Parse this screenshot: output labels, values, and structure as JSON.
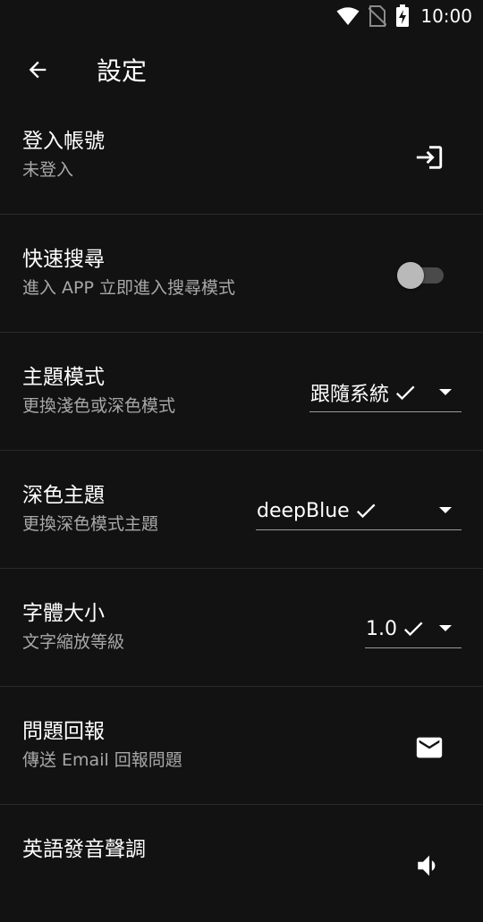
{
  "status_bar": {
    "time": "10:00",
    "icons": [
      "wifi-icon",
      "no-sim-icon",
      "battery-charging-icon"
    ]
  },
  "app_bar": {
    "back_icon": "arrow-left-icon",
    "title": "設定"
  },
  "settings": {
    "login": {
      "title": "登入帳號",
      "subtitle": "未登入",
      "icon": "login-icon"
    },
    "quick_search": {
      "title": "快速搜尋",
      "subtitle": "進入 APP 立即進入搜尋模式",
      "enabled": false
    },
    "theme_mode": {
      "title": "主題模式",
      "subtitle": "更換淺色或深色模式",
      "value": "跟隨系統"
    },
    "dark_theme": {
      "title": "深色主題",
      "subtitle": "更換深色模式主題",
      "value": "deepBlue"
    },
    "font_size": {
      "title": "字體大小",
      "subtitle": "文字縮放等級",
      "value": "1.0"
    },
    "feedback": {
      "title": "問題回報",
      "subtitle": "傳送 Email 回報問題",
      "icon": "mail-icon"
    },
    "pronunciation": {
      "title": "英語發音聲調",
      "icon": "speaker-icon"
    }
  },
  "colors": {
    "background": "#121212",
    "text_primary": "#ffffff",
    "text_secondary": "#a8a8a8",
    "divider": "#2a2a2a",
    "switch_track": "#4a4a4a",
    "switch_thumb": "#b9b9b9"
  }
}
